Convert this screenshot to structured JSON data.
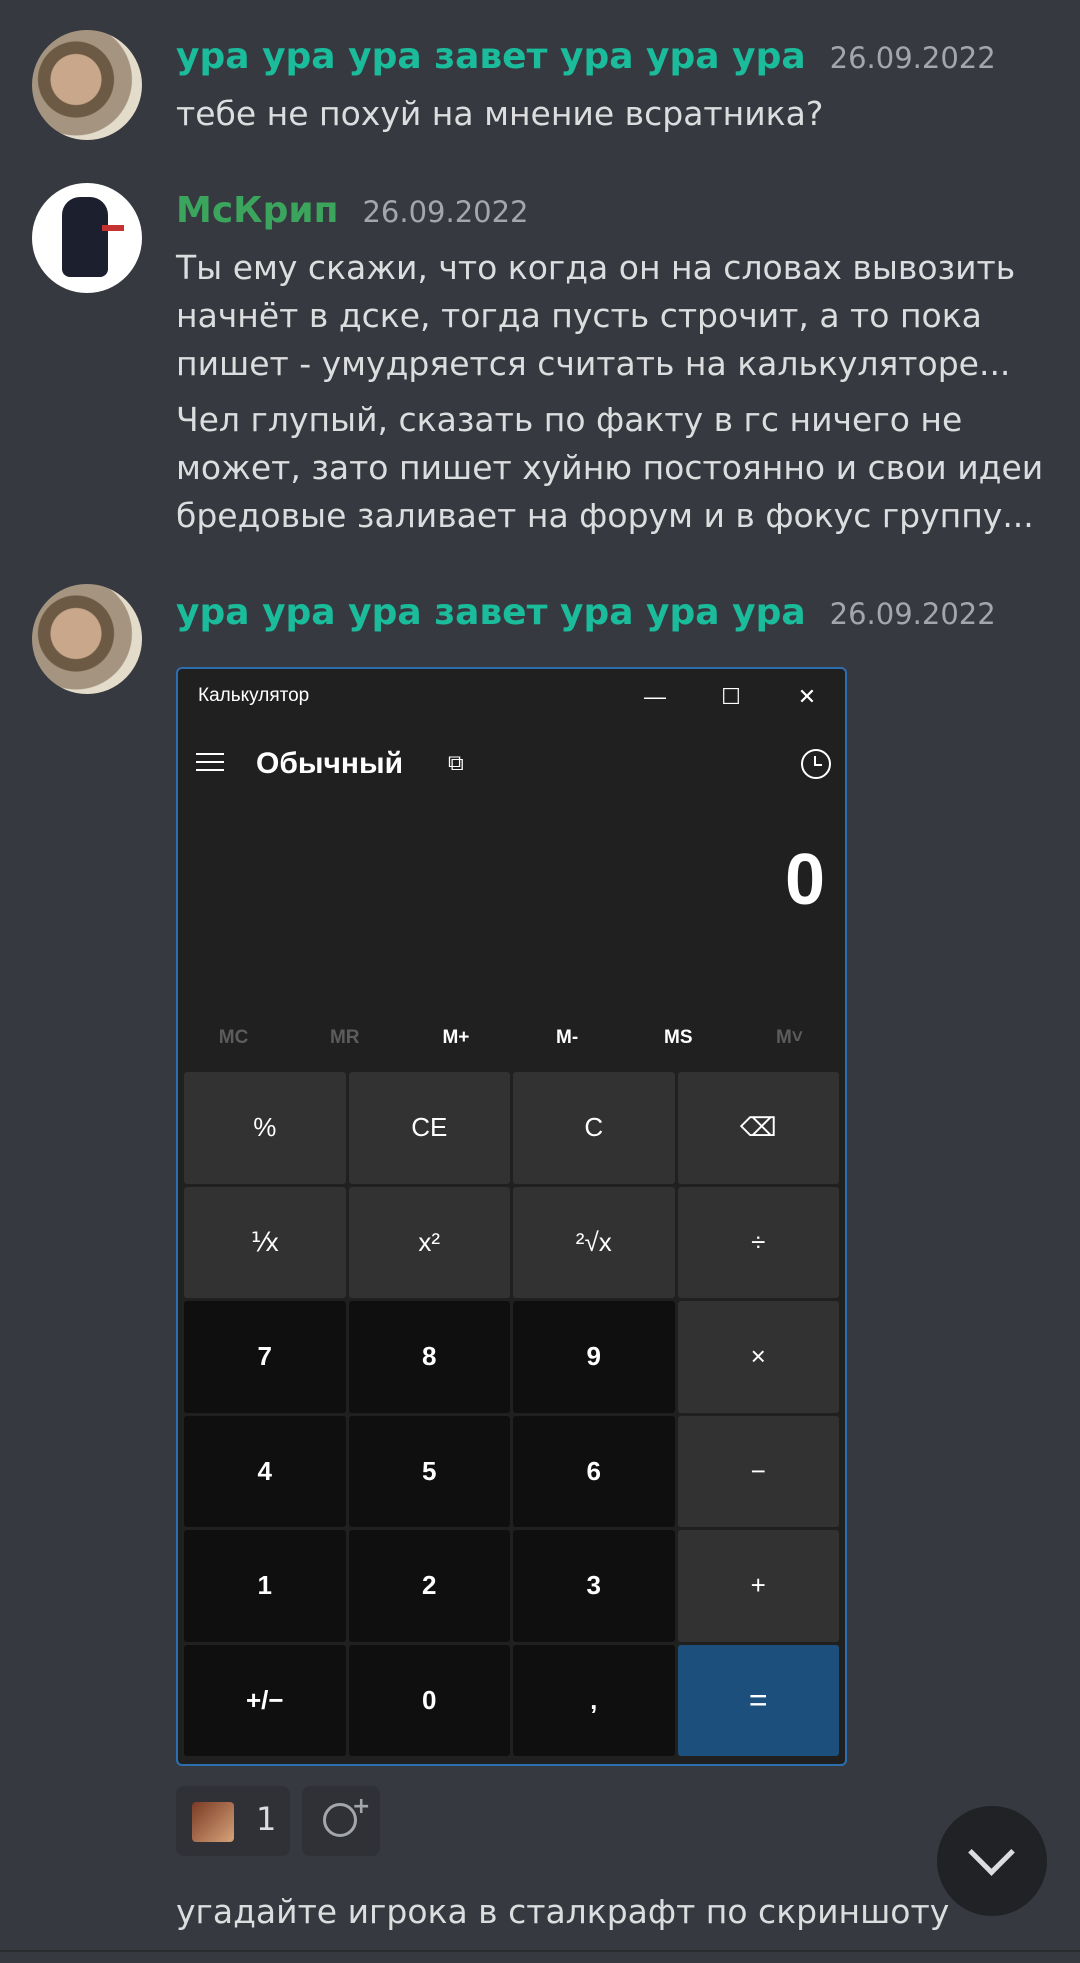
{
  "messages": [
    {
      "author": "ура ура ура завет ура ура ура",
      "timestamp": "26.09.2022",
      "lines": [
        "тебе не похуй на мнение всратника?"
      ]
    },
    {
      "author": "МсКрип",
      "timestamp": "26.09.2022",
      "lines": [
        "Ты ему скажи, что когда он на словах вывозить начнёт в дске, тогда пусть строчит, а то пока пишет - умудряется считать на калькуляторе...",
        "Чел глупый, сказать по факту в гс ничего не может, зато пишет хуйню постоянно и свои идеи бредовые заливает на форум и в фокус группу..."
      ]
    },
    {
      "author": "ура ура ура завет ура ура ура",
      "timestamp": "26.09.2022"
    }
  ],
  "calculator": {
    "window_title": "Калькулятор",
    "window_buttons": [
      "—",
      "☐",
      "✕"
    ],
    "mode": "Обычный",
    "display": "0",
    "memory": [
      {
        "label": "MC",
        "enabled": false
      },
      {
        "label": "MR",
        "enabled": false
      },
      {
        "label": "M+",
        "enabled": true
      },
      {
        "label": "M-",
        "enabled": true
      },
      {
        "label": "MS",
        "enabled": true
      },
      {
        "label": "M˅",
        "enabled": false
      }
    ],
    "keys": [
      "%",
      "CE",
      "C",
      "⌫",
      "⅟x",
      "x²",
      "²√x",
      "÷",
      "7",
      "8",
      "9",
      "×",
      "4",
      "5",
      "6",
      "−",
      "1",
      "2",
      "3",
      "+",
      "+/−",
      "0",
      ",",
      "="
    ]
  },
  "reactions": {
    "count": "1",
    "add_icon": "add-reaction-icon"
  },
  "last_message": "угадайте игрока в сталкрафт по скриншоту",
  "colors": {
    "background": "#36393f",
    "name_teal": "#1abc9c",
    "name_green": "#3ba55d",
    "equals": "#1d4f7c"
  }
}
